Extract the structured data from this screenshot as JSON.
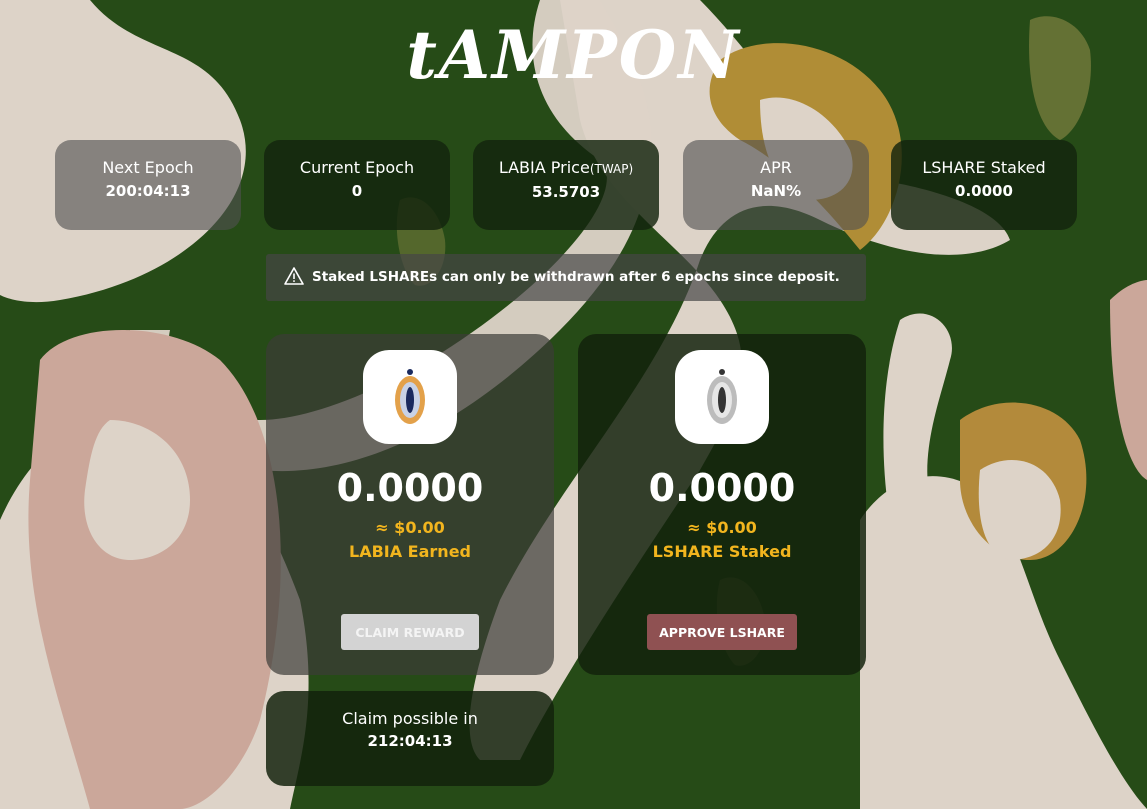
{
  "brand": {
    "logo_text": "tAMPON"
  },
  "stats": [
    {
      "label": "Next Epoch",
      "value": "200:04:13"
    },
    {
      "label": "Current Epoch",
      "value": "0"
    },
    {
      "label": "LABIA Price",
      "label_suffix": "(TWAP)",
      "value": "53.5703"
    },
    {
      "label": "APR",
      "value": "NaN%"
    },
    {
      "label": "LSHARE Staked",
      "value": "0.0000"
    }
  ],
  "notice": {
    "icon": "warning-icon",
    "text": "Staked LSHAREs can only be withdrawn after 6 epochs since deposit."
  },
  "earn_card": {
    "icon": "labia-token-icon",
    "amount": "0.0000",
    "usd": "≈ $0.00",
    "label": "LABIA Earned",
    "button": "CLAIM REWARD"
  },
  "stake_card": {
    "icon": "lshare-token-icon",
    "amount": "0.0000",
    "usd": "≈ $0.00",
    "label": "LSHARE Staked",
    "button": "APPROVE LSHARE"
  },
  "claim_timer": {
    "label": "Claim possible in",
    "value": "212:04:13"
  },
  "colors": {
    "background": "#264b17",
    "accent": "#f2b51e",
    "approve_button": "#8f5152",
    "claim_button": "#d3d3d3"
  }
}
